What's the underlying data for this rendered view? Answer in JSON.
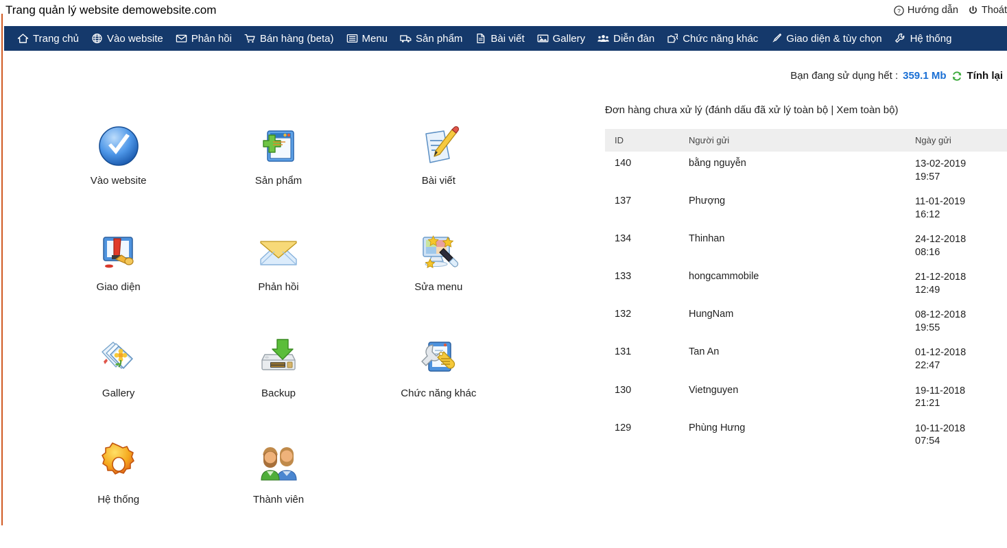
{
  "header": {
    "title": "Trang quản lý website demowebsite.com",
    "links": [
      {
        "label": "Hướng dẫn",
        "icon": "help-circle-icon"
      },
      {
        "label": "Thoát",
        "icon": "power-icon"
      }
    ]
  },
  "nav": {
    "items": [
      {
        "label": "Trang chủ",
        "icon": "home-icon"
      },
      {
        "label": "Vào website",
        "icon": "globe-icon"
      },
      {
        "label": "Phản hồi",
        "icon": "envelope-icon"
      },
      {
        "label": "Bán hàng (beta)",
        "icon": "shopping-cart-icon"
      },
      {
        "label": "Menu",
        "icon": "list-icon"
      },
      {
        "label": "Sản phẩm",
        "icon": "truck-icon"
      },
      {
        "label": "Bài viết",
        "icon": "file-text-icon"
      },
      {
        "label": "Gallery",
        "icon": "image-icon"
      },
      {
        "label": "Diễn đàn",
        "icon": "users-icon"
      },
      {
        "label": "Chức năng khác",
        "icon": "puzzle-icon"
      },
      {
        "label": "Giao diện & tùy chọn",
        "icon": "paintbrush-icon"
      },
      {
        "label": "Hệ thống",
        "icon": "wrench-icon"
      }
    ]
  },
  "storage": {
    "prefix": "Bạn đang sử dụng hết :",
    "value": "359.1 Mb",
    "recalc_label": "Tính lại",
    "refresh_icon": "refresh-icon",
    "value_color": "#1a6fd4",
    "refresh_color": "#3aa93a"
  },
  "shortcuts": [
    {
      "label": "Vào website",
      "icon": "blue-check-circle-icon"
    },
    {
      "label": "Sản phẩm",
      "icon": "window-plus-icon"
    },
    {
      "label": "Bài viết",
      "icon": "document-pencil-icon"
    },
    {
      "label": "Giao diện",
      "icon": "paint-roller-icon"
    },
    {
      "label": "Phản hồi",
      "icon": "mail-envelope-icon"
    },
    {
      "label": "Sửa menu",
      "icon": "monitor-wand-icon"
    },
    {
      "label": "Gallery",
      "icon": "photos-flower-icon"
    },
    {
      "label": "Backup",
      "icon": "hard-drive-download-icon"
    },
    {
      "label": "Chức năng khác",
      "icon": "wrench-tag-icon"
    },
    {
      "label": "Hệ thống",
      "icon": "orange-gear-icon"
    },
    {
      "label": "Thành viên",
      "icon": "two-people-icon"
    }
  ],
  "orders": {
    "title_prefix": "Đơn hàng chưa xử lý (",
    "link_mark_all": "đánh dấu đã xử lý toàn bộ",
    "separator": "|",
    "link_view_all": "Xem toàn bộ",
    "title_suffix": ")",
    "columns": [
      "ID",
      "Người gửi",
      "Ngày gửi"
    ],
    "rows": [
      {
        "id": "140",
        "sender": "bằng nguyễn",
        "date": "13-02-2019\n19:57"
      },
      {
        "id": "137",
        "sender": "Phượng",
        "date": "11-01-2019\n16:12"
      },
      {
        "id": "134",
        "sender": "Thinhan",
        "date": "24-12-2018\n08:16"
      },
      {
        "id": "133",
        "sender": "hongcammobile",
        "date": "21-12-2018\n12:49"
      },
      {
        "id": "132",
        "sender": "HungNam",
        "date": "08-12-2018\n19:55"
      },
      {
        "id": "131",
        "sender": "Tan An",
        "date": "01-12-2018\n22:47"
      },
      {
        "id": "130",
        "sender": "Vietnguyen",
        "date": "19-11-2018\n21:21"
      },
      {
        "id": "129",
        "sender": "Phùng Hưng",
        "date": "10-11-2018\n07:54"
      }
    ]
  },
  "theme": {
    "nav_background": "#15396b",
    "page_background": "#ffffff",
    "table_header_background": "#eeeeee",
    "left_border": "#d05a22"
  }
}
